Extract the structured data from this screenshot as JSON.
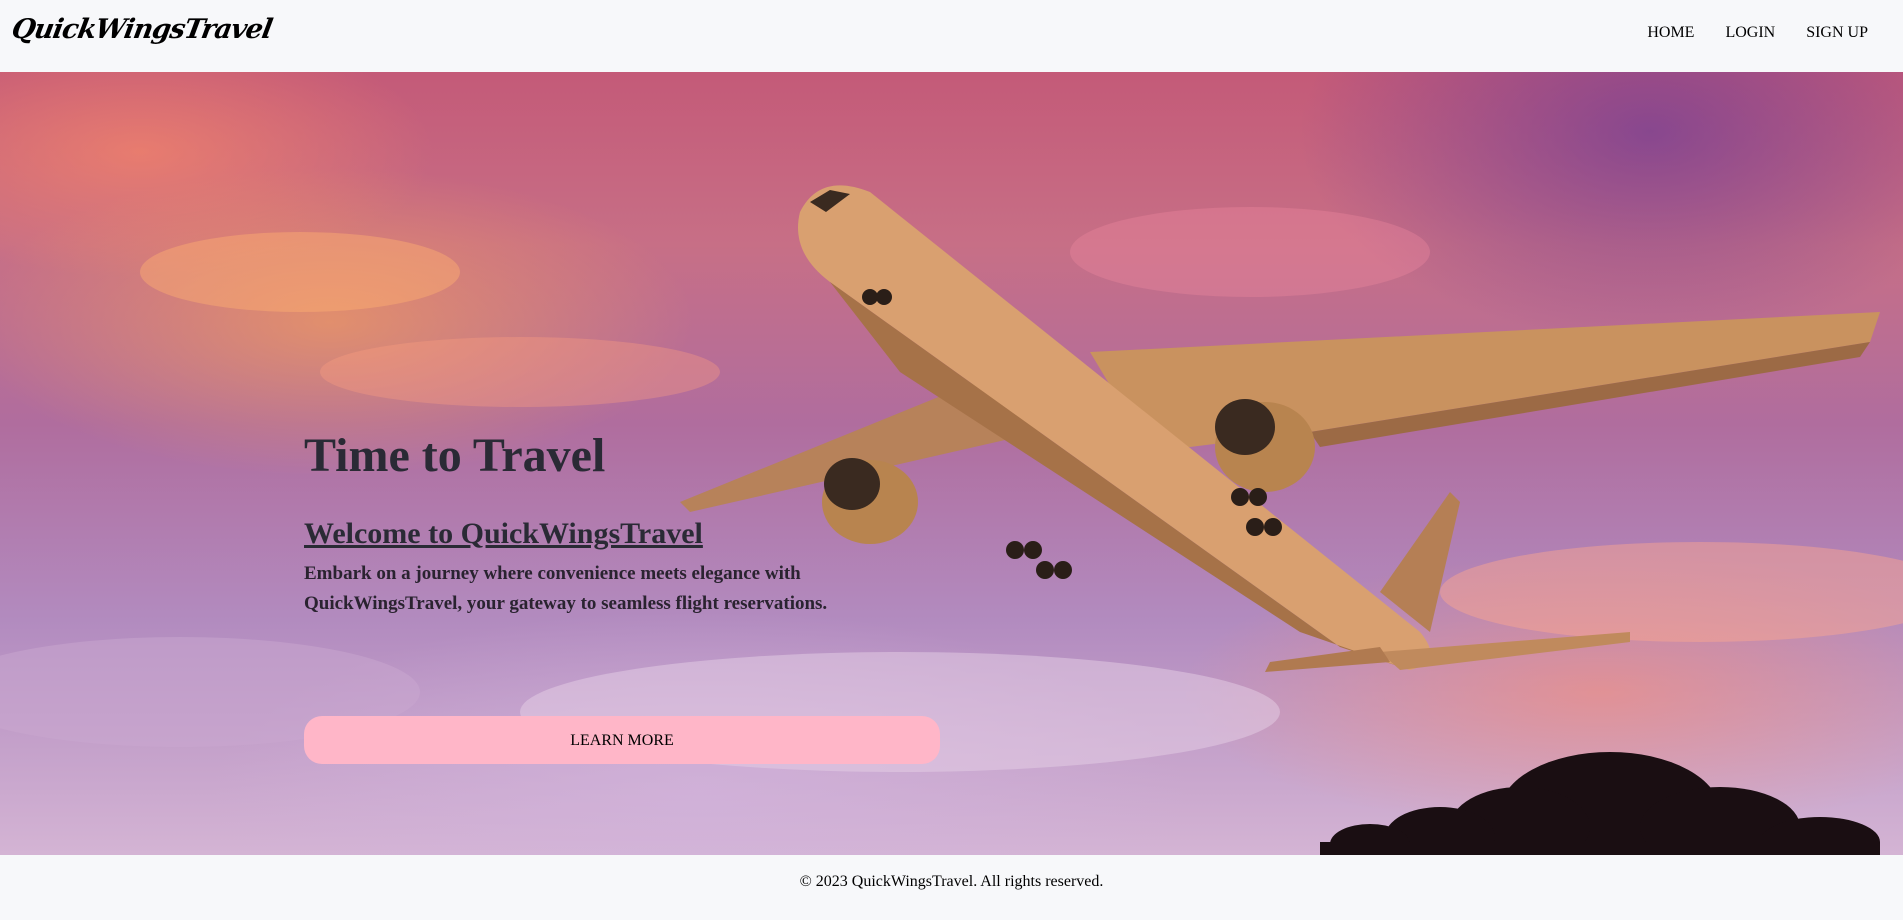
{
  "header": {
    "brand": "QuickWingsTravel",
    "nav": [
      {
        "label": "HOME"
      },
      {
        "label": "LOGIN"
      },
      {
        "label": "SIGN UP"
      }
    ]
  },
  "hero": {
    "title": "Time to Travel",
    "subtitle": "Welcome to QuickWingsTravel",
    "description": "Embark on a journey where convenience meets elegance with QuickWingsTravel, your gateway to seamless flight reservations.",
    "button_label": "LEARN MORE",
    "image_icon": "airplane-sunset-image",
    "colors": {
      "button_bg": "#ffb6c8",
      "sky_top": "#c45a78",
      "sky_bottom": "#d4b4d4",
      "plane": "#c9925f"
    }
  },
  "footer": {
    "copyright": "© 2023 QuickWingsTravel. All rights reserved."
  }
}
